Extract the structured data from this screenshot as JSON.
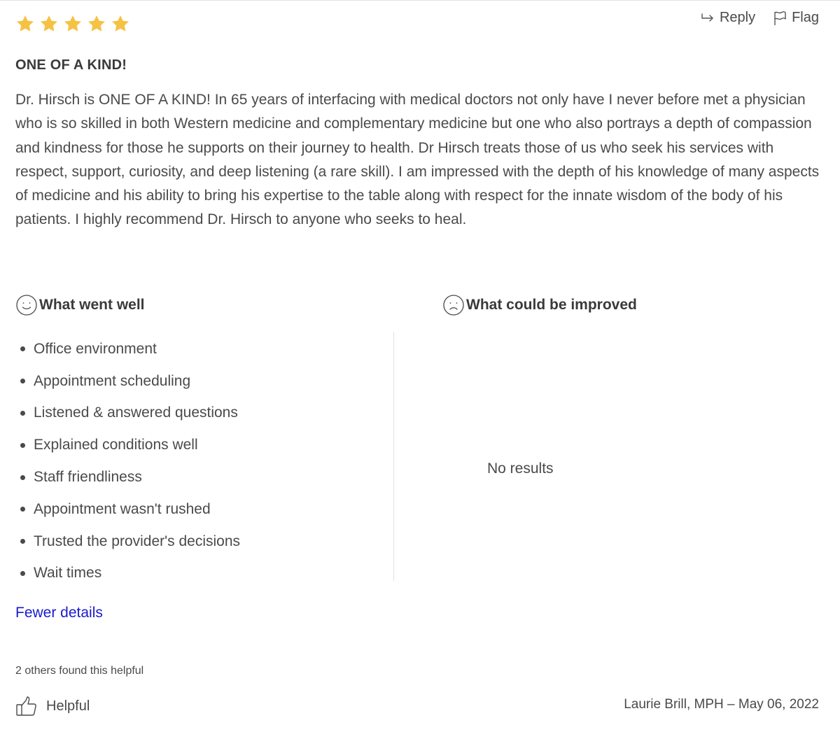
{
  "rating": {
    "value": 5,
    "max": 5,
    "star_color": "#F5C242"
  },
  "actions": {
    "reply_label": "Reply",
    "flag_label": "Flag"
  },
  "review": {
    "title": "ONE OF A KIND!",
    "body": "Dr. Hirsch is ONE OF A KIND! In 65 years of interfacing with medical doctors not only have I never before met a physician who is so skilled in both Western medicine and complementary medicine but one who also portrays a depth of compassion and kindness for those he supports on their journey to health. Dr Hirsch treats those of us who seek his services with respect, support, curiosity, and deep listening (a rare skill). I am impressed with the depth of his knowledge of many aspects of medicine and his ability to bring his expertise to the table along with respect for the innate wisdom of the body of his patients. I highly recommend Dr. Hirsch to anyone who seeks to heal."
  },
  "went_well": {
    "heading": "What went well",
    "icon": "smile-icon",
    "items": [
      "Office environment",
      "Appointment scheduling",
      "Listened & answered questions",
      "Explained conditions well",
      "Staff friendliness",
      "Appointment wasn't rushed",
      "Trusted the provider's decisions",
      "Wait times"
    ]
  },
  "could_improve": {
    "heading": "What could be improved",
    "icon": "frown-icon",
    "empty_text": "No results"
  },
  "details_toggle": "Fewer details",
  "helpful": {
    "count_text": "2 others found this helpful",
    "button_label": "Helpful"
  },
  "author_line": "Laurie Brill, MPH – May 06, 2022",
  "colors": {
    "link": "#1A1ACC",
    "text": "#4A4A4A"
  }
}
